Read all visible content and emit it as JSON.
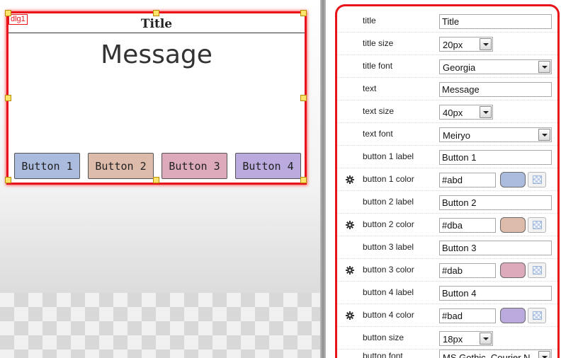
{
  "dialog": {
    "id_label": "dlg1",
    "title": "Title",
    "message": "Message",
    "buttons": [
      {
        "label": "Button 1",
        "color": "#aabbdd"
      },
      {
        "label": "Button 2",
        "color": "#ddbbaa"
      },
      {
        "label": "Button 3",
        "color": "#ddaabb"
      },
      {
        "label": "Button 4",
        "color": "#bbaadd"
      }
    ]
  },
  "properties": {
    "title": {
      "label": "title",
      "value": "Title"
    },
    "title_size": {
      "label": "title size",
      "value": "20px"
    },
    "title_font": {
      "label": "title font",
      "value": "Georgia"
    },
    "text": {
      "label": "text",
      "value": "Message"
    },
    "text_size": {
      "label": "text size",
      "value": "40px"
    },
    "text_font": {
      "label": "text font",
      "value": "Meiryo"
    },
    "button1_label": {
      "label": "button 1 label",
      "value": "Button 1"
    },
    "button1_color": {
      "label": "button 1 color",
      "value": "#abd",
      "swatch": "#aabbdd"
    },
    "button2_label": {
      "label": "button 2 label",
      "value": "Button 2"
    },
    "button2_color": {
      "label": "button 2 color",
      "value": "#dba",
      "swatch": "#ddbbaa"
    },
    "button3_label": {
      "label": "button 3 label",
      "value": "Button 3"
    },
    "button3_color": {
      "label": "button 3 color",
      "value": "#dab",
      "swatch": "#ddaabb"
    },
    "button4_label": {
      "label": "button 4 label",
      "value": "Button 4"
    },
    "button4_color": {
      "label": "button 4 color",
      "value": "#bad",
      "swatch": "#bbaadd"
    },
    "button_size": {
      "label": "button size",
      "value": "18px"
    },
    "button_font": {
      "label": "button font",
      "value": "MS Gothic, Courier N"
    }
  },
  "colors": {
    "selection_red": "#e8121a",
    "handle_yellow": "#ffe36b"
  }
}
